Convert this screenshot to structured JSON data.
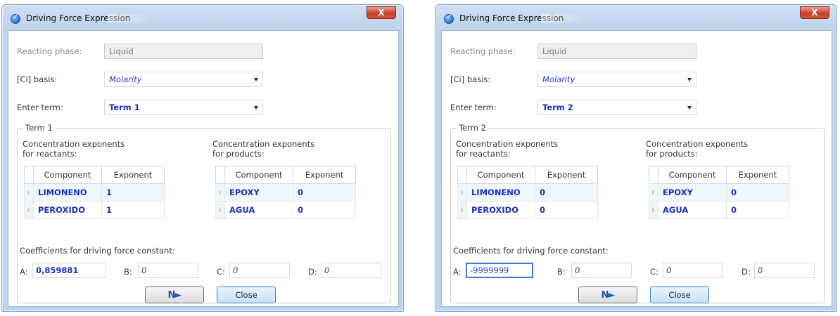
{
  "dialogs": [
    {
      "title": "Driving Force Expression",
      "close_label": "X",
      "reacting_phase_label": "Reacting phase:",
      "reacting_phase_value": "Liquid",
      "ci_basis_label": "[Ci] basis:",
      "ci_basis_value": "Molarity",
      "enter_term_label": "Enter term:",
      "enter_term_value": "Term 1",
      "group_title": "Term 1",
      "reactants_header": "Concentration exponents\nfor reactants:",
      "products_header": "Concentration exponents\nfor products:",
      "col_component": "Component",
      "col_exponent": "Exponent",
      "reactants": [
        {
          "component": "LIMONENO",
          "exponent": "1"
        },
        {
          "component": "PEROXIDO",
          "exponent": "1"
        }
      ],
      "products": [
        {
          "component": "EPOXY",
          "exponent": "0"
        },
        {
          "component": "AGUA",
          "exponent": "0"
        }
      ],
      "coefficients_label": "Coefficients for driving force constant:",
      "coef_labels": {
        "a": "A:",
        "b": "B:",
        "c": "C:",
        "d": "D:"
      },
      "coef_values": {
        "a": "0,859881",
        "b": "0",
        "c": "0",
        "d": "0"
      },
      "close_button": "Close"
    },
    {
      "title": "Driving Force Expression",
      "close_label": "X",
      "reacting_phase_label": "Reacting phase:",
      "reacting_phase_value": "Liquid",
      "ci_basis_label": "[Ci] basis:",
      "ci_basis_value": "Molarity",
      "enter_term_label": "Enter term:",
      "enter_term_value": "Term 2",
      "group_title": "Term 2",
      "reactants_header": "Concentration exponents\nfor reactants:",
      "products_header": "Concentration exponents\nfor products:",
      "col_component": "Component",
      "col_exponent": "Exponent",
      "reactants": [
        {
          "component": "LIMONENO",
          "exponent": "0"
        },
        {
          "component": "PEROXIDO",
          "exponent": "0"
        }
      ],
      "products": [
        {
          "component": "EPOXY",
          "exponent": "0"
        },
        {
          "component": "AGUA",
          "exponent": "0"
        }
      ],
      "coefficients_label": "Coefficients for driving force constant:",
      "coef_labels": {
        "a": "A:",
        "b": "B:",
        "c": "C:",
        "d": "D:"
      },
      "coef_values": {
        "a": "-9999999",
        "b": "0",
        "c": "0",
        "d": "0"
      },
      "close_button": "Close"
    }
  ],
  "colors": {
    "accent_text": "#1b2fb8",
    "close_button_red": "#c7402a",
    "focus_border": "#3c7fd1"
  },
  "icons": {
    "title_icon": "check-circle-icon",
    "next_button_icon": "next-arrow-icon"
  }
}
